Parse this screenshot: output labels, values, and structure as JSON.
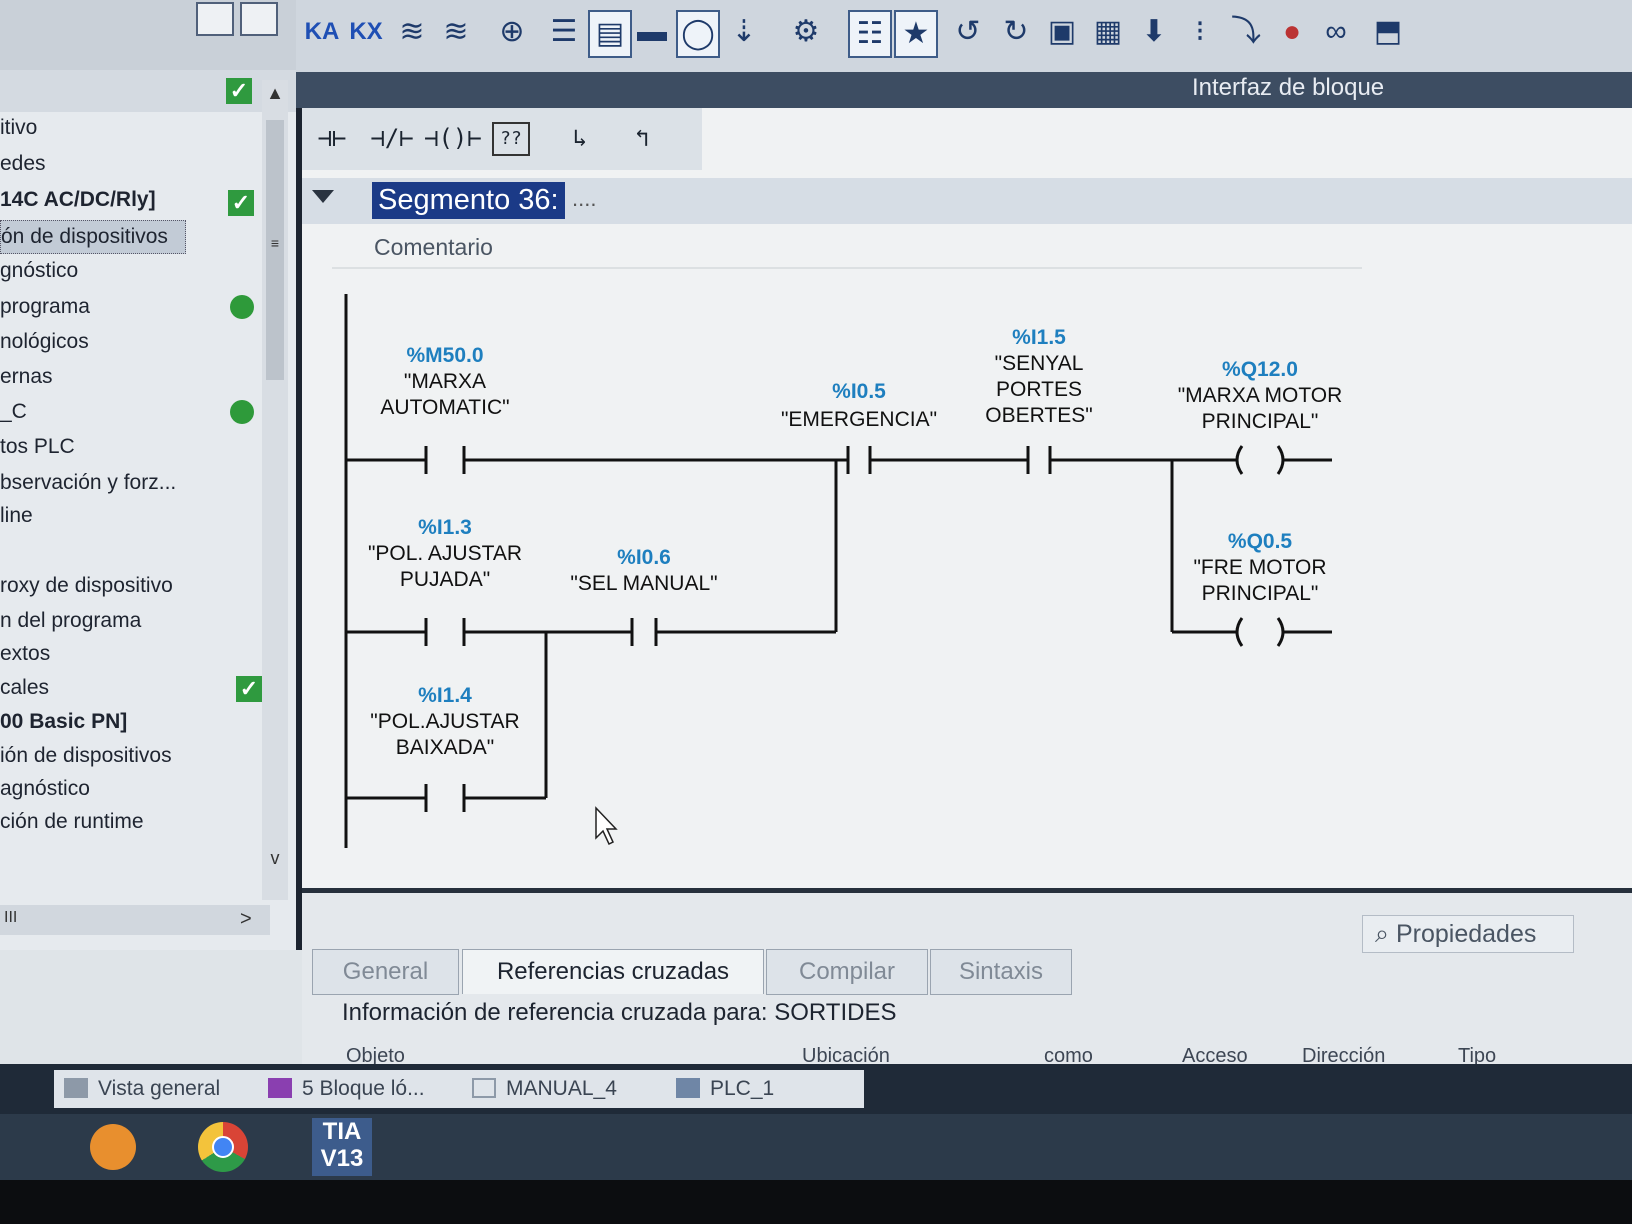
{
  "tree": {
    "items": [
      {
        "label": "itivo",
        "status": ""
      },
      {
        "label": "edes",
        "status": ""
      },
      {
        "label": "14C AC/DC/Rly]",
        "status": "check"
      },
      {
        "label": "ón de dispositivos",
        "status": "",
        "selected": true
      },
      {
        "label": "gnóstico",
        "status": ""
      },
      {
        "label": "programa",
        "status": "ok"
      },
      {
        "label": "nológicos",
        "status": ""
      },
      {
        "label": "ernas",
        "status": ""
      },
      {
        "label": "_C",
        "status": "ok"
      },
      {
        "label": "tos PLC",
        "status": ""
      },
      {
        "label": "bservación y forz...",
        "status": ""
      },
      {
        "label": "line",
        "status": ""
      },
      {
        "label": "roxy de dispositivo",
        "status": ""
      },
      {
        "label": "n del programa",
        "status": ""
      },
      {
        "label": "extos",
        "status": ""
      },
      {
        "label": "cales",
        "status": "check"
      },
      {
        "label": "00 Basic PN]",
        "status": ""
      },
      {
        "label": "ión de dispositivos",
        "status": ""
      },
      {
        "label": "agnóstico",
        "status": ""
      },
      {
        "label": "ción de runtime",
        "status": ""
      }
    ],
    "header_status": "check",
    "scroll_up": "▲",
    "scroll_down": "v",
    "hscroll_left": "III",
    "hscroll_right": ">"
  },
  "toolbar": {
    "block_interface": "Interfaz de bloque",
    "ladder_buttons": [
      "⊣⊢",
      "⊣/⊢",
      "⊣()⊢",
      "??",
      "↳",
      "↰"
    ]
  },
  "segment": {
    "title": "Segmento 36:",
    "dots": "....",
    "comment": "Comentario"
  },
  "ladder": {
    "contacts": [
      {
        "address": "%M50.0",
        "name_line1": "\"MARXA",
        "name_line2": "AUTOMATIC\""
      },
      {
        "address": "%I1.3",
        "name_line1": "\"POL. AJUSTAR",
        "name_line2": "PUJADA\""
      },
      {
        "address": "%I0.6",
        "name_line1": "\"SEL MANUAL\"",
        "name_line2": ""
      },
      {
        "address": "%I1.4",
        "name_line1": "\"POL.AJUSTAR",
        "name_line2": "BAIXADA\""
      },
      {
        "address": "%I0.5",
        "name_line1": "\"EMERGENCIA\"",
        "name_line2": ""
      },
      {
        "address": "%I1.5",
        "name_line1": "\"SENYAL",
        "name_line2": "PORTES",
        "name_line3": "OBERTES\""
      }
    ],
    "coils": [
      {
        "address": "%Q12.0",
        "name_line1": "\"MARXA MOTOR",
        "name_line2": "PRINCIPAL\""
      },
      {
        "address": "%Q0.5",
        "name_line1": "\"FRE MOTOR",
        "name_line2": "PRINCIPAL\""
      }
    ]
  },
  "inspector": {
    "properties": "Propiedades",
    "tabs": [
      "General",
      "Referencias cruzadas",
      "Compilar",
      "Sintaxis"
    ],
    "active_tab": "Referencias cruzadas",
    "info": "Información de referencia cruzada para: SORTIDES",
    "columns": [
      "Objeto",
      "Ubicación",
      "como",
      "Acceso",
      "Dirección",
      "Tipo"
    ]
  },
  "editor_tabs": [
    {
      "label": "Vista general"
    },
    {
      "label": "5 Bloque ló..."
    },
    {
      "label": "MANUAL_4"
    },
    {
      "label": "PLC_1"
    }
  ],
  "taskbar": {
    "tia_line1": "TIA",
    "tia_line2": "V13"
  }
}
